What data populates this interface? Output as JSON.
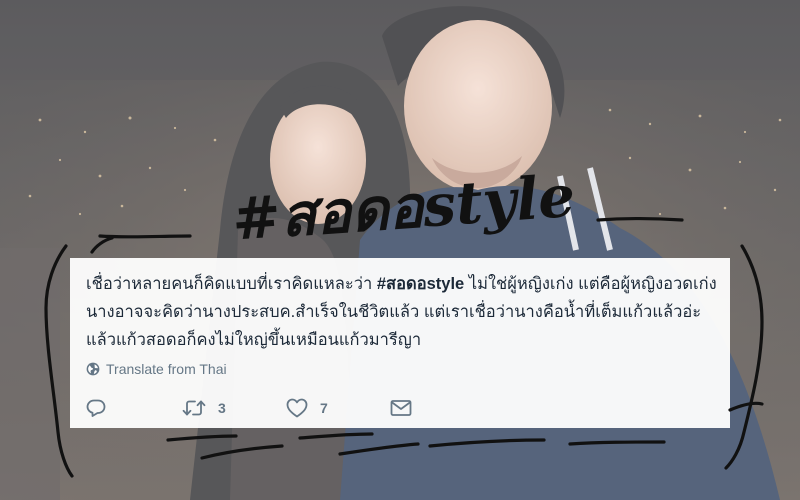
{
  "title": "#สอดอstyle",
  "tweet": {
    "text_before": "เชื่อว่าหลายคนก็คิดแบบที่เราคิดแหละว่า ",
    "hashtag": "#สอดอstyle",
    "text_after": " ไม่ใช่ผู้หญิงเก่ง แต่คือผู้หญิงอวดเก่ง นางอาจจะคิดว่านางประสบค.สำเร็จในชีวิตแล้ว แต่เราเชื่อว่านางคือน้ำที่เต็มแก้วแล้วอ่ะ แล้วแก้วสอดอก็คงไม่ใหญ่ขึ้นเหมือนแก้วมารีญา",
    "translate_label": "Translate from Thai",
    "retweet_count": "3",
    "like_count": "7"
  },
  "icons": {
    "translate": "globe-icon",
    "reply": "reply-icon",
    "retweet": "retweet-icon",
    "like": "heart-icon",
    "message": "envelope-icon"
  },
  "colors": {
    "tweet_text": "#1c2938",
    "muted": "#657786",
    "ink": "#111111"
  }
}
